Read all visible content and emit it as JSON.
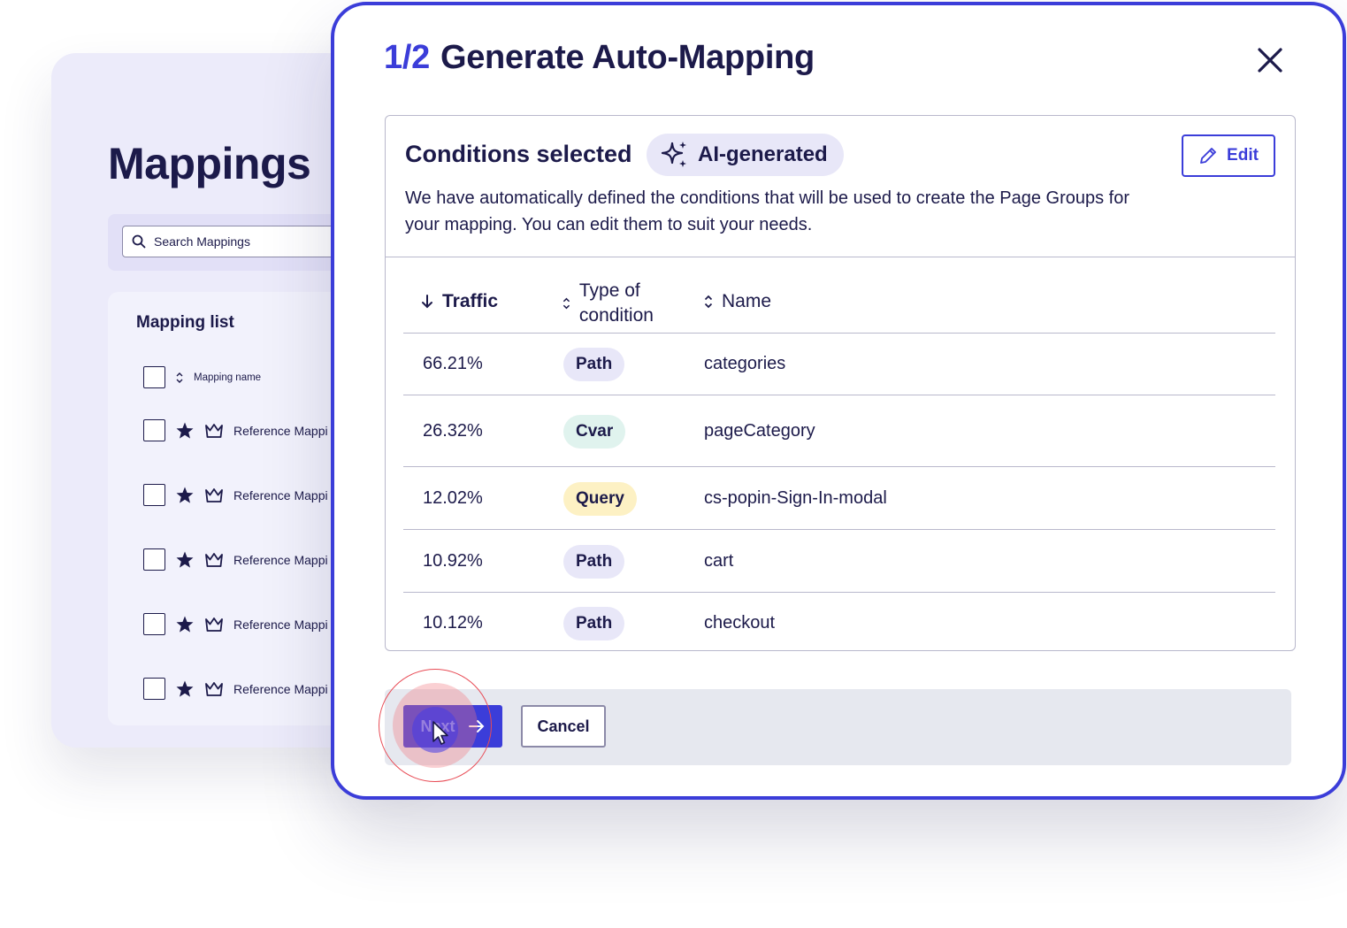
{
  "background": {
    "title": "Mappings",
    "search": {
      "placeholder": "Search Mappings"
    },
    "list_title": "Mapping list",
    "column_header": "Mapping name",
    "rows": [
      {
        "label": "Reference Mappi"
      },
      {
        "label": "Reference Mappi"
      },
      {
        "label": "Reference Mappi"
      },
      {
        "label": "Reference Mappi"
      },
      {
        "label": "Reference Mappi"
      }
    ]
  },
  "modal": {
    "step": "1/2",
    "title": "Generate Auto-Mapping",
    "conditions": {
      "title": "Conditions selected",
      "badge": "AI-generated",
      "edit_label": "Edit",
      "description": "We have automatically defined the conditions that will be used to create the Page Groups for your mapping. You can edit them to suit your needs."
    },
    "table": {
      "headers": {
        "traffic": "Traffic",
        "type": "Type of condition",
        "name": "Name"
      },
      "rows": [
        {
          "traffic": "66.21%",
          "type": "Path",
          "name": "categories",
          "color": "#e8e7f8"
        },
        {
          "traffic": "26.32%",
          "type": "Cvar",
          "name": "pageCategory",
          "color": "#e0f3ee"
        },
        {
          "traffic": "12.02%",
          "type": "Query",
          "name": "cs-popin-Sign-In-modal",
          "color": "#fdf1c4"
        },
        {
          "traffic": "10.92%",
          "type": "Path",
          "name": "cart",
          "color": "#e8e7f8"
        },
        {
          "traffic": "10.12%",
          "type": "Path",
          "name": "checkout",
          "color": "#e8e7f8"
        }
      ]
    },
    "footer": {
      "next_label": "Next",
      "cancel_label": "Cancel"
    }
  },
  "colors": {
    "accent": "#3b3dd9",
    "text": "#1c1a4a",
    "click_ring": "#e84b55"
  }
}
